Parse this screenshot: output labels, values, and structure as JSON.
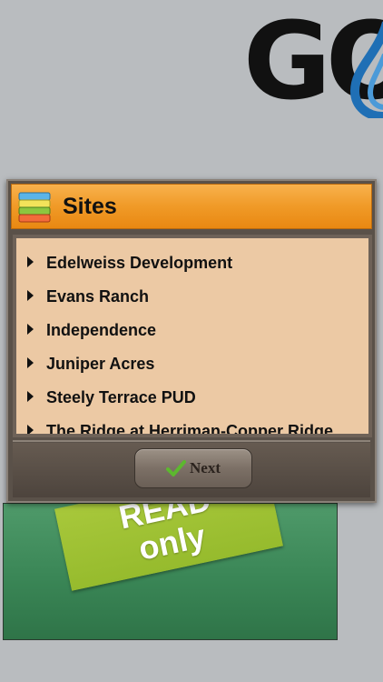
{
  "logo": {
    "text": "GO"
  },
  "background_card": {
    "ribbon_line1": "READ",
    "ribbon_line2": "only"
  },
  "dialog": {
    "title": "Sites",
    "header_icon": "layers-icon",
    "items": [
      {
        "label": "Edelweiss Development"
      },
      {
        "label": "Evans Ranch"
      },
      {
        "label": "Independence"
      },
      {
        "label": "Juniper Acres"
      },
      {
        "label": "Steely Terrace PUD"
      },
      {
        "label": "The Ridge at Herriman-Copper Ridge"
      }
    ],
    "next_button": {
      "label": "Next",
      "icon": "checkmark-icon"
    }
  },
  "colors": {
    "header_orange": "#f09a27",
    "list_background": "#ecc9a4",
    "checkmark_green": "#5cb82e",
    "ribbon_green": "#a8c83b"
  }
}
